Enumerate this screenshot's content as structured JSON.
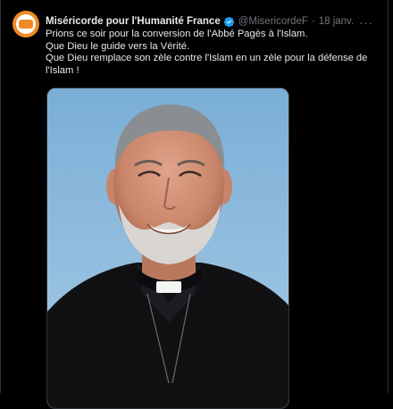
{
  "tweet": {
    "author_name": "Miséricorde pour l'Humanité France",
    "handle": "@MisericordeF",
    "separator": "·",
    "date": "18 janv.",
    "more_label": "···",
    "lines": [
      "Prions ce soir pour la conversion de l'Abbé Pagès à l'Islam.",
      "Que Dieu le guide vers la Vérité.",
      "Que Dieu remplace son zèle contre l'Islam en un zèle pour la défense de l'Islam !"
    ]
  },
  "icons": {
    "avatar": "avatar-logo",
    "verified": "verified-badge-icon",
    "more": "more-options-icon"
  },
  "colors": {
    "background": "#000000",
    "text": "#e7e9ea",
    "secondary": "#71767b",
    "verified": "#1d9bf0",
    "avatar": "#f08a24"
  }
}
